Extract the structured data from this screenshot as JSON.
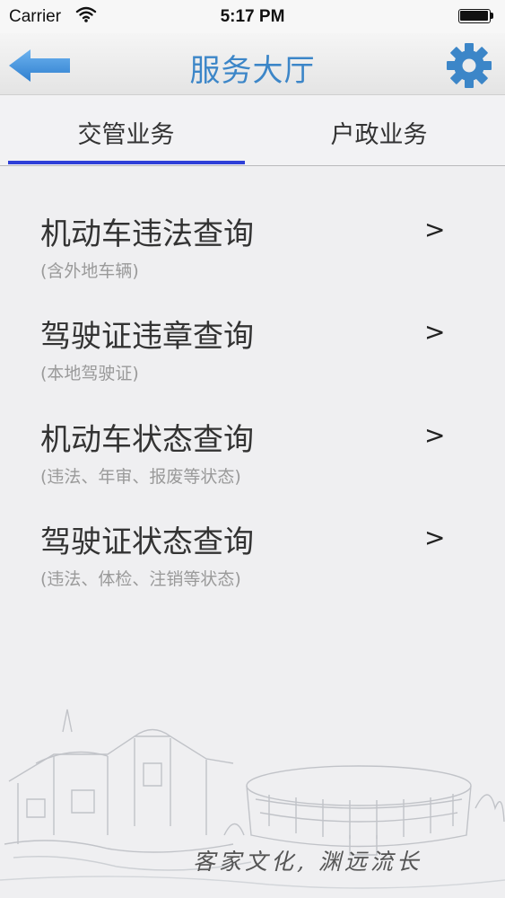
{
  "status_bar": {
    "carrier": "Carrier",
    "time": "5:17 PM",
    "icons": [
      "wifi-icon",
      "battery-icon"
    ]
  },
  "nav": {
    "title": "服务大厅",
    "back_icon": "arrow-left-icon",
    "settings_icon": "gear-icon",
    "accent_color": "#3c86c8"
  },
  "tabs": [
    {
      "label": "交管业务",
      "selected": true
    },
    {
      "label": "户政业务",
      "selected": false
    }
  ],
  "tab_indicator_color": "#2e3fd8",
  "list": [
    {
      "title": "机动车违法查询",
      "subtitle": "(含外地车辆)",
      "chevron": ">"
    },
    {
      "title": "驾驶证违章查询",
      "subtitle": "(本地驾驶证)",
      "chevron": ">"
    },
    {
      "title": "机动车状态查询",
      "subtitle": "(违法、年审、报废等状态)",
      "chevron": ">"
    },
    {
      "title": "驾驶证状态查询",
      "subtitle": "(违法、体检、注销等状态)",
      "chevron": ">"
    }
  ],
  "footer": {
    "slogan": "客家文化, 渊远流长"
  }
}
